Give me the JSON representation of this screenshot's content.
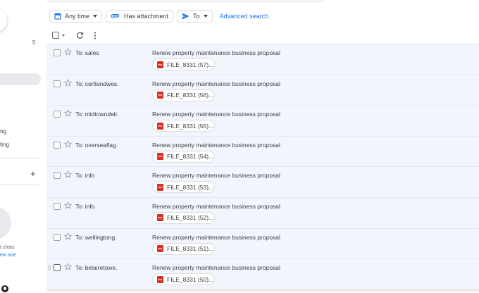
{
  "sidebar": {
    "badge_count": "5",
    "label_1": "ng",
    "label_2": "ting",
    "chat_line_1": "t chats",
    "chat_link": "ew one"
  },
  "filters": {
    "any_time": "Any time",
    "has_attachment": "Has attachment",
    "to": "To",
    "advanced_search": "Advanced search"
  },
  "emails": [
    {
      "to": "To: sales",
      "subject": "Renew property maintenance business proposal",
      "attachment": "FILE_8331 (57)..."
    },
    {
      "to": "To: cortlandwes.",
      "subject": "Renew property maintenance business proposal",
      "attachment": "FILE_8331 (56)..."
    },
    {
      "to": "To: midtowndelr.",
      "subject": "Renew property maintenance business proposal",
      "attachment": "FILE_8331 (55)..."
    },
    {
      "to": "To: overseaflag.",
      "subject": "Renew property maintenance business proposal",
      "attachment": "FILE_8331 (54)..."
    },
    {
      "to": "To: info",
      "subject": "Renew property maintenance business proposal",
      "attachment": "FILE_8331 (53)..."
    },
    {
      "to": "To: info",
      "subject": "Renew property maintenance business proposal",
      "attachment": "FILE_8331 (52)..."
    },
    {
      "to": "To: wellingtong.",
      "subject": "Renew property maintenance business proposal",
      "attachment": "FILE_8331 (51)..."
    },
    {
      "to": "To: belairetowe.",
      "subject": "Renew property maintenance business proposal",
      "attachment": "FILE_8331 (50)..."
    }
  ],
  "colors": {
    "accent": "#1a73e8",
    "row_bg": "#f2f6fc",
    "pdf_red": "#d93025"
  },
  "icons": {
    "calendar": "calendar-icon",
    "attachment": "attachment-icon",
    "send": "send-icon",
    "refresh": "refresh-icon",
    "more": "more-vert-icon",
    "star": "star-icon",
    "pdf": "pdf-icon"
  }
}
